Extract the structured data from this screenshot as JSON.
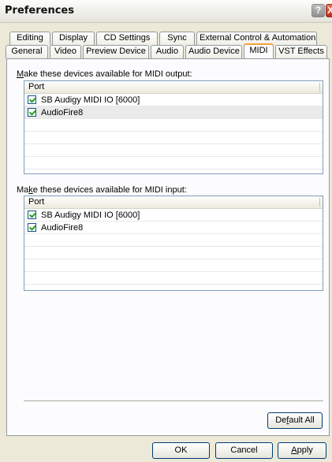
{
  "window": {
    "title": "Preferences",
    "help_glyph": "?",
    "close_glyph": "X"
  },
  "tabs": {
    "back_row": [
      "Editing",
      "Display",
      "CD Settings",
      "Sync",
      "External Control & Automation"
    ],
    "front_row": [
      "General",
      "Video",
      "Preview Device",
      "Audio",
      "Audio Device",
      "MIDI",
      "VST Effects"
    ],
    "active": "MIDI"
  },
  "output_section": {
    "label_first": "M",
    "label_rest": "ake these devices available for MIDI output:",
    "column_header": "Port",
    "devices": [
      {
        "name": "SB Audigy MIDI IO [6000]",
        "checked": true
      },
      {
        "name": "AudioFire8",
        "checked": true
      }
    ]
  },
  "input_section": {
    "label_pre": "Ma",
    "label_underline": "k",
    "label_rest": "e these devices available for MIDI input:",
    "column_header": "Port",
    "devices": [
      {
        "name": "SB Audigy MIDI IO [6000]",
        "checked": true
      },
      {
        "name": "AudioFire8",
        "checked": true
      }
    ]
  },
  "buttons": {
    "default_pre": "De",
    "default_underline": "f",
    "default_rest": "ault All",
    "ok": "OK",
    "cancel": "Cancel",
    "apply_underline": "A",
    "apply_rest": "pply"
  },
  "colors": {
    "active_tab_accent": "#f3a13b",
    "check_mark": "#21a121"
  }
}
